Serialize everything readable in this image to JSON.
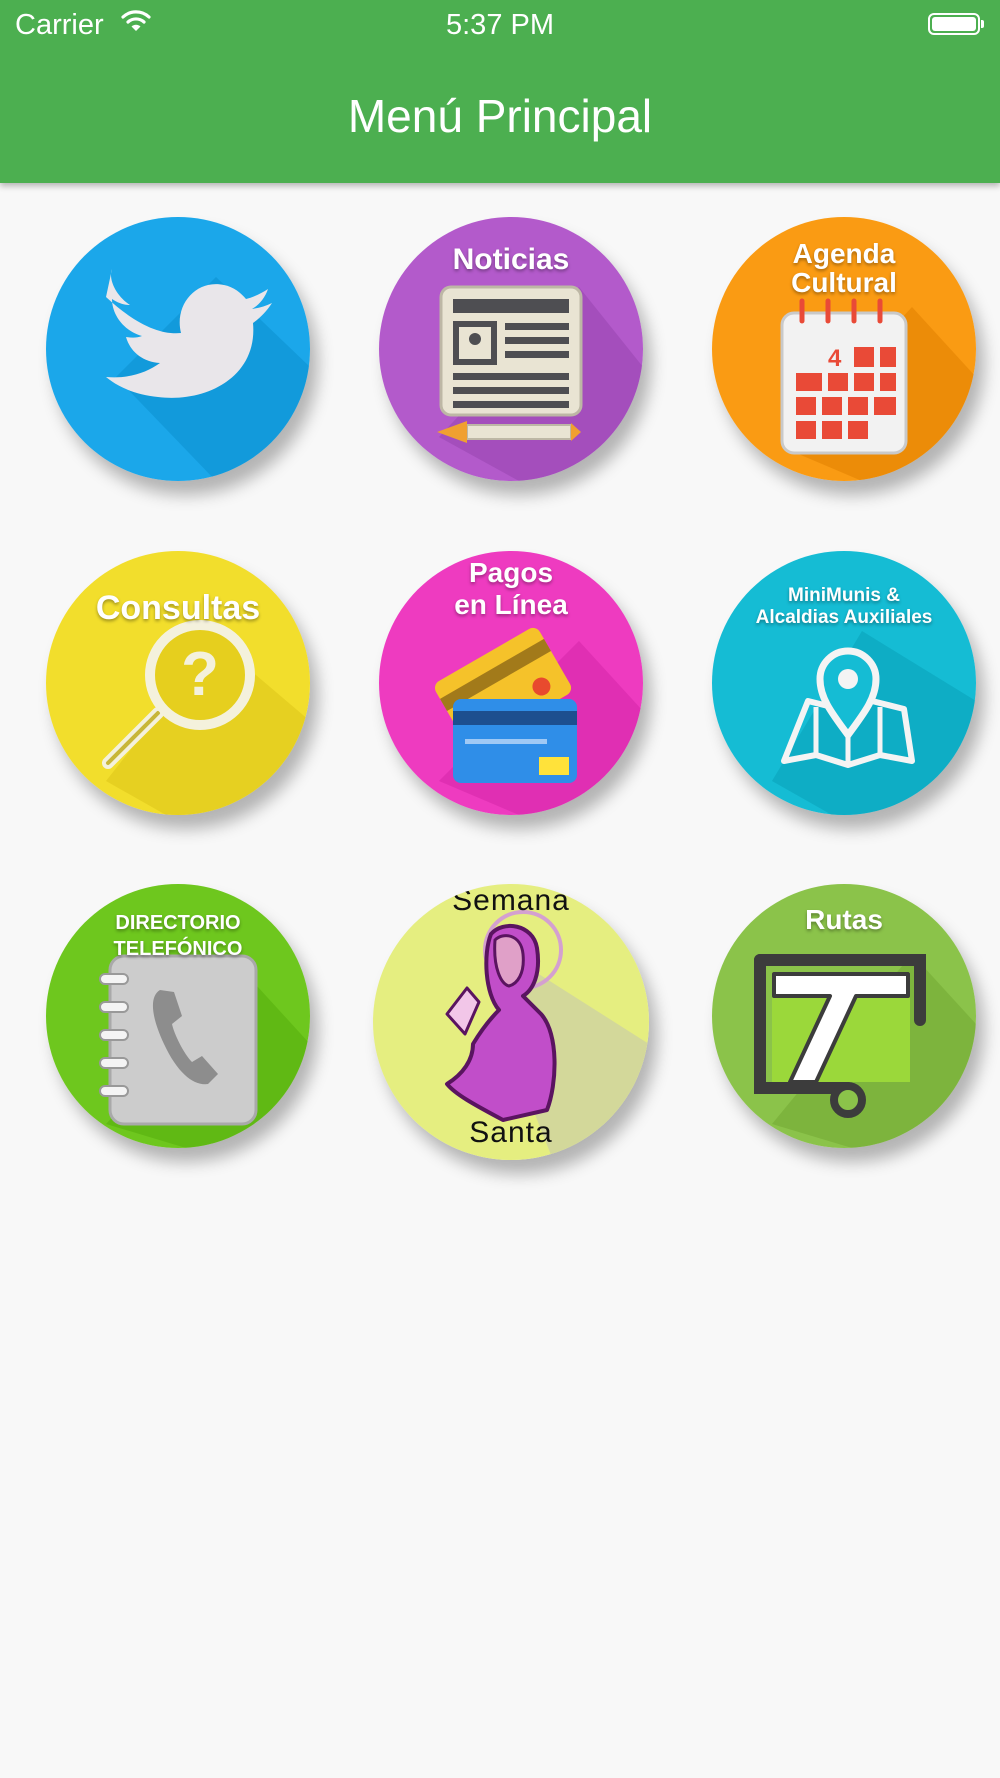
{
  "status_bar": {
    "carrier": "Carrier",
    "time": "5:37 PM",
    "icons": [
      "wifi-icon",
      "battery-icon"
    ]
  },
  "header": {
    "title": "Menú Principal"
  },
  "menu": {
    "twitter": {
      "icon": "twitter-bird-icon",
      "color": "#1da9ec"
    },
    "noticias": {
      "label": "Noticias",
      "icon": "newspaper-icon",
      "color": "#b35acb"
    },
    "agenda": {
      "label_1": "Agenda",
      "label_2": "Cultural",
      "icon": "calendar-icon",
      "calendar_day": "4",
      "color": "#fa9b13"
    },
    "consultas": {
      "label": "Consultas",
      "icon": "question-magnifier-icon",
      "color": "#f2de2c"
    },
    "pagos": {
      "label_1": "Pagos",
      "label_2": "en Línea",
      "icon": "credit-card-icon",
      "color": "#ee3bc0"
    },
    "minimunis": {
      "label_1": "MiniMunis &",
      "label_2": "Alcaldias Auxiliales",
      "icon": "map-pin-icon",
      "color": "#15bcd4"
    },
    "directorio": {
      "label_1": "DIRECTORIO",
      "label_2": "TELEFÓNICO",
      "icon": "phone-book-icon",
      "color": "#6ec71e"
    },
    "semana_santa": {
      "label_1": "Semana",
      "label_2": "Santa",
      "icon": "praying-figure-icon",
      "color": "#e5ee80"
    },
    "rutas": {
      "label": "Rutas",
      "icon": "transport-route-icon",
      "color": "#8bc34a"
    }
  }
}
